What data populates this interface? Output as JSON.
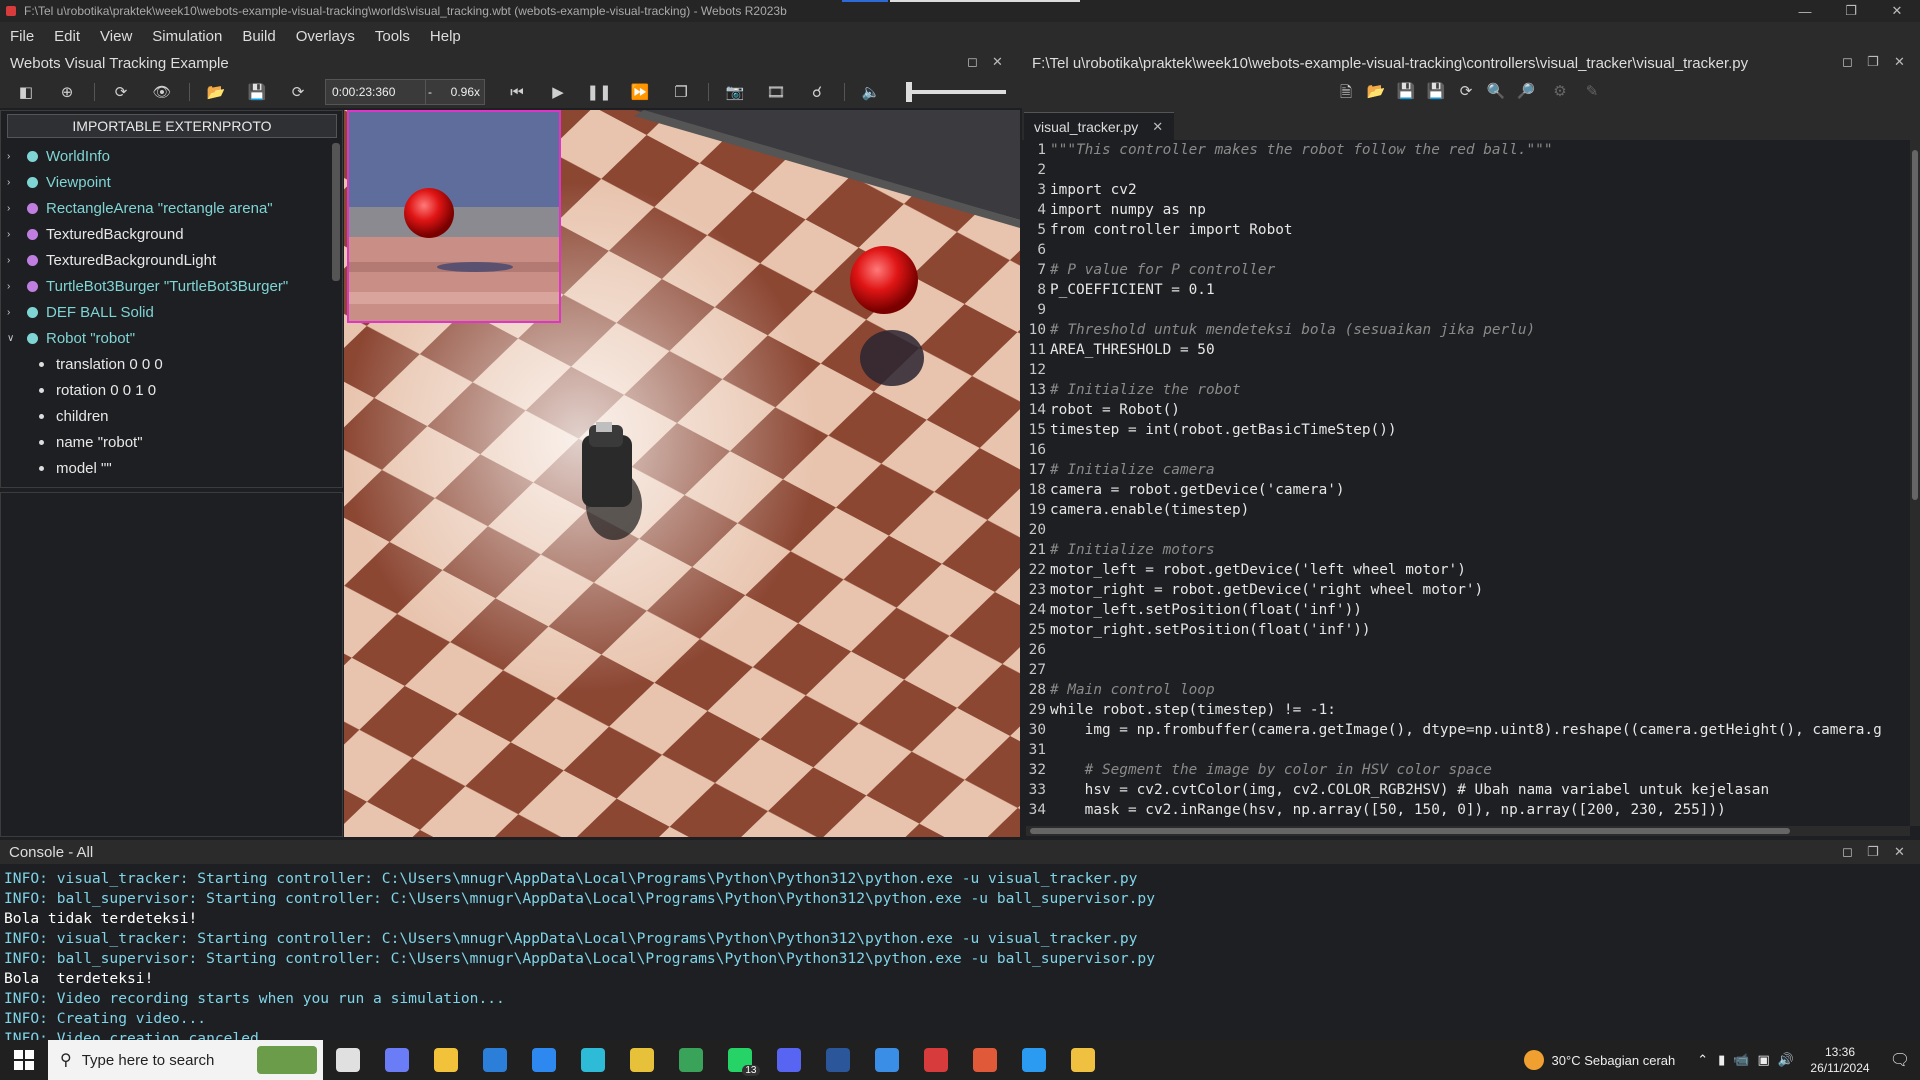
{
  "window": {
    "title": "F:\\Tel u\\robotika\\praktek\\week10\\webots-example-visual-tracking\\worlds\\visual_tracking.wbt (webots-example-visual-tracking) - Webots R2023b"
  },
  "menu": [
    "File",
    "Edit",
    "View",
    "Simulation",
    "Build",
    "Overlays",
    "Tools",
    "Help"
  ],
  "world_panel": {
    "title": "Webots Visual Tracking Example",
    "time": "0:00:23:360",
    "speed_sep": "-",
    "speed": "0.96x"
  },
  "scene_tree": {
    "import_button": "IMPORTABLE EXTERNPROTO",
    "nodes": [
      {
        "label": "WorldInfo",
        "color": "#7fd4d4",
        "text_color": "#7fd4d4"
      },
      {
        "label": "Viewpoint",
        "color": "#7fd4d4",
        "text_color": "#7fd4d4"
      },
      {
        "label": "RectangleArena \"rectangle arena\"",
        "color": "#c07fe0",
        "text_color": "#7fd4d4"
      },
      {
        "label": "TexturedBackground",
        "color": "#c07fe0",
        "text_color": "#e8e8e8"
      },
      {
        "label": "TexturedBackgroundLight",
        "color": "#c07fe0",
        "text_color": "#e8e8e8"
      },
      {
        "label": "TurtleBot3Burger \"TurtleBot3Burger\"",
        "color": "#c07fe0",
        "text_color": "#7fd4d4"
      },
      {
        "label": "DEF BALL Solid",
        "color": "#7fd4d4",
        "text_color": "#7fd4d4"
      },
      {
        "label": "Robot \"robot\"",
        "color": "#7fd4d4",
        "text_color": "#7fd4d4"
      }
    ],
    "robot_fields": [
      "translation 0 0 0",
      "rotation 0 0 1 0",
      "children",
      "name \"robot\"",
      "model \"\""
    ]
  },
  "editor": {
    "title": "F:\\Tel u\\robotika\\praktek\\week10\\webots-example-visual-tracking\\controllers\\visual_tracker\\visual_tracker.py",
    "tab": "visual_tracker.py",
    "lines": [
      "\"\"\"This controller makes the robot follow the red ball.\"\"\"",
      "",
      "import cv2",
      "import numpy as np",
      "from controller import Robot",
      "",
      "# P value for P controller",
      "P_COEFFICIENT = 0.1",
      "",
      "# Threshold untuk mendeteksi bola (sesuaikan jika perlu)",
      "AREA_THRESHOLD = 50",
      "",
      "# Initialize the robot",
      "robot = Robot()",
      "timestep = int(robot.getBasicTimeStep())",
      "",
      "# Initialize camera",
      "camera = robot.getDevice('camera')",
      "camera.enable(timestep)",
      "",
      "# Initialize motors",
      "motor_left = robot.getDevice('left wheel motor')",
      "motor_right = robot.getDevice('right wheel motor')",
      "motor_left.setPosition(float('inf'))",
      "motor_right.setPosition(float('inf'))",
      "",
      "",
      "# Main control loop",
      "while robot.step(timestep) != -1:",
      "    img = np.frombuffer(camera.getImage(), dtype=np.uint8).reshape((camera.getHeight(), camera.g",
      "",
      "    # Segment the image by color in HSV color space",
      "    hsv = cv2.cvtColor(img, cv2.COLOR_RGB2HSV) # Ubah nama variabel untuk kejelasan",
      "    mask = cv2.inRange(hsv, np.array([50, 150, 0]), np.array([200, 230, 255]))"
    ]
  },
  "console": {
    "title": "Console - All",
    "lines": [
      {
        "text": "INFO: visual_tracker: Starting controller: C:\\Users\\mnugr\\AppData\\Local\\Programs\\Python\\Python312\\python.exe -u visual_tracker.py",
        "color": "#7fd4e8"
      },
      {
        "text": "INFO: ball_supervisor: Starting controller: C:\\Users\\mnugr\\AppData\\Local\\Programs\\Python\\Python312\\python.exe -u ball_supervisor.py",
        "color": "#7fd4e8"
      },
      {
        "text": "Bola tidak terdeteksi!",
        "color": "#ffffff"
      },
      {
        "text": "INFO: visual_tracker: Starting controller: C:\\Users\\mnugr\\AppData\\Local\\Programs\\Python\\Python312\\python.exe -u visual_tracker.py",
        "color": "#7fd4e8"
      },
      {
        "text": "INFO: ball_supervisor: Starting controller: C:\\Users\\mnugr\\AppData\\Local\\Programs\\Python\\Python312\\python.exe -u ball_supervisor.py",
        "color": "#7fd4e8"
      },
      {
        "text": "Bola  terdeteksi!",
        "color": "#ffffff"
      },
      {
        "text": "INFO: Video recording starts when you run a simulation...",
        "color": "#7fd4e8"
      },
      {
        "text": "INFO: Creating video...",
        "color": "#7fd4e8"
      },
      {
        "text": "INFO: Video creation canceled.",
        "color": "#7fd4e8"
      }
    ]
  },
  "taskbar": {
    "search_placeholder": "Type here to search",
    "weather": "30°C  Sebagian cerah",
    "time": "13:36",
    "date": "26/11/2024",
    "apps": [
      {
        "name": "task-view",
        "color": "#e0e0e0"
      },
      {
        "name": "copilot",
        "color": "#6b7cf7"
      },
      {
        "name": "file-explorer",
        "color": "#f2c23a"
      },
      {
        "name": "microsoft-store",
        "color": "#2b7fd8"
      },
      {
        "name": "mail",
        "color": "#2d89ef"
      },
      {
        "name": "edge",
        "color": "#2dbbd8"
      },
      {
        "name": "chrome",
        "color": "#e8c13a"
      },
      {
        "name": "chrome-profile",
        "color": "#3aa35a"
      },
      {
        "name": "whatsapp",
        "color": "#25d366"
      },
      {
        "name": "discord",
        "color": "#5865f2"
      },
      {
        "name": "word",
        "color": "#2b579a"
      },
      {
        "name": "snipping-tool",
        "color": "#3a8ee6"
      },
      {
        "name": "webots",
        "color": "#d83b3b"
      },
      {
        "name": "chrome-2",
        "color": "#e05a3a"
      },
      {
        "name": "vscode",
        "color": "#2a9bf0"
      },
      {
        "name": "app-diamond",
        "color": "#f0c040"
      }
    ],
    "whatsapp_badge": "13"
  }
}
